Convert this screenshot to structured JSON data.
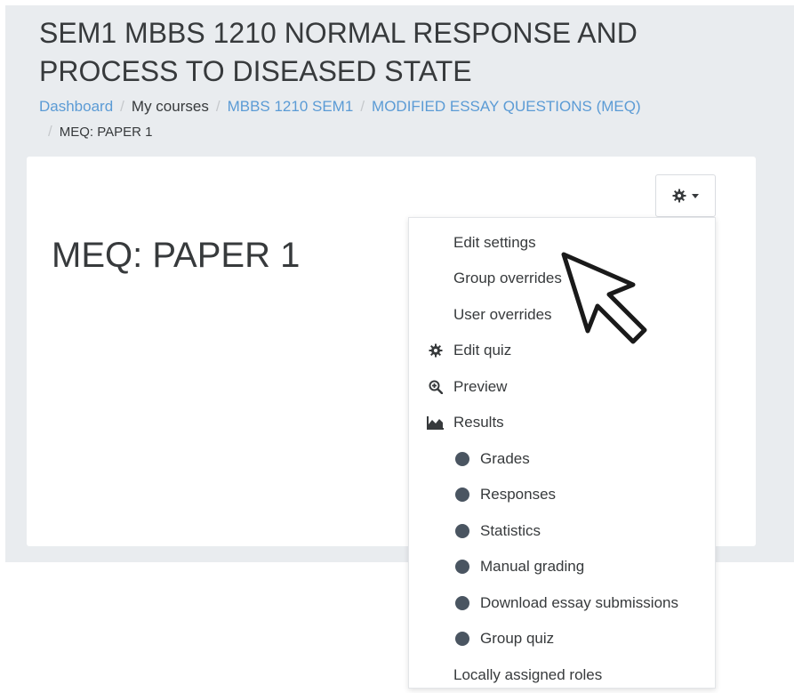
{
  "header": {
    "course_title": "SEM1 MBBS 1210 NORMAL RESPONSE AND PROCESS TO DISEASED STATE"
  },
  "breadcrumb": [
    {
      "label": "Dashboard",
      "link": true
    },
    {
      "label": "My courses",
      "link": false
    },
    {
      "label": "MBBS 1210 SEM1",
      "link": true
    },
    {
      "label": "MODIFIED ESSAY QUESTIONS (MEQ)",
      "link": true
    },
    {
      "label": "MEQ: PAPER 1",
      "link": false
    }
  ],
  "main": {
    "quiz_title": "MEQ: PAPER 1",
    "actions_button_icon": "gear-icon"
  },
  "menu": {
    "items": [
      {
        "label": "Edit settings",
        "icon": ""
      },
      {
        "label": "Group overrides",
        "icon": ""
      },
      {
        "label": "User overrides",
        "icon": ""
      },
      {
        "label": "Edit quiz",
        "icon": "gear-icon"
      },
      {
        "label": "Preview",
        "icon": "zoom-in-icon"
      },
      {
        "label": "Results",
        "icon": "area-chart-icon"
      },
      {
        "label": "Grades",
        "icon": "dot-icon"
      },
      {
        "label": "Responses",
        "icon": "dot-icon"
      },
      {
        "label": "Statistics",
        "icon": "dot-icon"
      },
      {
        "label": "Manual grading",
        "icon": "dot-icon"
      },
      {
        "label": "Download essay submissions",
        "icon": "dot-icon"
      },
      {
        "label": "Group quiz",
        "icon": "dot-icon"
      },
      {
        "label": "Locally assigned roles",
        "icon": ""
      }
    ]
  },
  "colors": {
    "page_bg": "#e9ecef",
    "link": "#5b9bd5",
    "text": "#373a3c",
    "bullet": "#4a5561"
  }
}
